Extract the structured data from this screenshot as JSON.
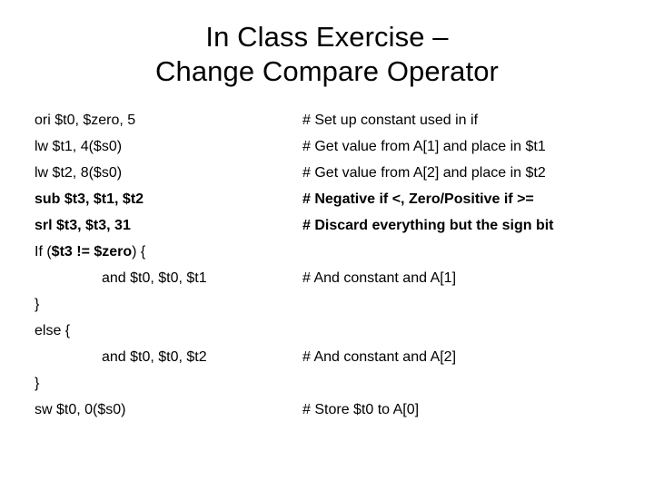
{
  "slide": {
    "background_color": "#ffffff",
    "text_color": "#000000"
  },
  "title": {
    "line1": "In Class Exercise –",
    "line2": "Change Compare Operator"
  },
  "code": {
    "lines": [
      {
        "instruction": "ori $t0, $zero, 5",
        "instruction_bold": false,
        "indented": false,
        "comment": "# Set up constant used in if",
        "comment_bold": false
      },
      {
        "instruction": "lw $t1, 4($s0)",
        "instruction_bold": false,
        "indented": false,
        "comment": "# Get value from A[1] and place in $t1",
        "comment_bold": false
      },
      {
        "instruction": "lw $t2, 8($s0)",
        "instruction_bold": false,
        "indented": false,
        "comment": "# Get value from A[2] and place in $t2",
        "comment_bold": false
      },
      {
        "instruction": "sub $t3, $t1, $t2",
        "instruction_bold": true,
        "indented": false,
        "comment": "# Negative if <, Zero/Positive if >=",
        "comment_bold": true
      },
      {
        "instruction": "srl $t3, $t3, 31",
        "instruction_bold": true,
        "indented": false,
        "comment": "# Discard everything but the sign bit",
        "comment_bold": true
      },
      {
        "instruction_prefix": "If (",
        "instruction_emphasis": "$t3 != $zero",
        "instruction_suffix": ") {",
        "instruction_bold": false,
        "indented": false,
        "comment": "",
        "comment_bold": false
      },
      {
        "instruction": "and $t0, $t0, $t1",
        "instruction_bold": false,
        "indented": true,
        "comment": "# And constant and A[1]",
        "comment_bold": false
      },
      {
        "instruction": "}",
        "instruction_bold": false,
        "indented": false,
        "comment": "",
        "comment_bold": false
      },
      {
        "instruction": "else {",
        "instruction_bold": false,
        "indented": false,
        "comment": "",
        "comment_bold": false
      },
      {
        "instruction": "and $t0, $t0, $t2",
        "instruction_bold": false,
        "indented": true,
        "comment": "# And constant and A[2]",
        "comment_bold": false
      },
      {
        "instruction": "}",
        "instruction_bold": false,
        "indented": false,
        "comment": "",
        "comment_bold": false
      },
      {
        "instruction": "sw $t0, 0($s0)",
        "instruction_bold": false,
        "indented": false,
        "comment": "# Store $t0 to A[0]",
        "comment_bold": false
      }
    ]
  }
}
